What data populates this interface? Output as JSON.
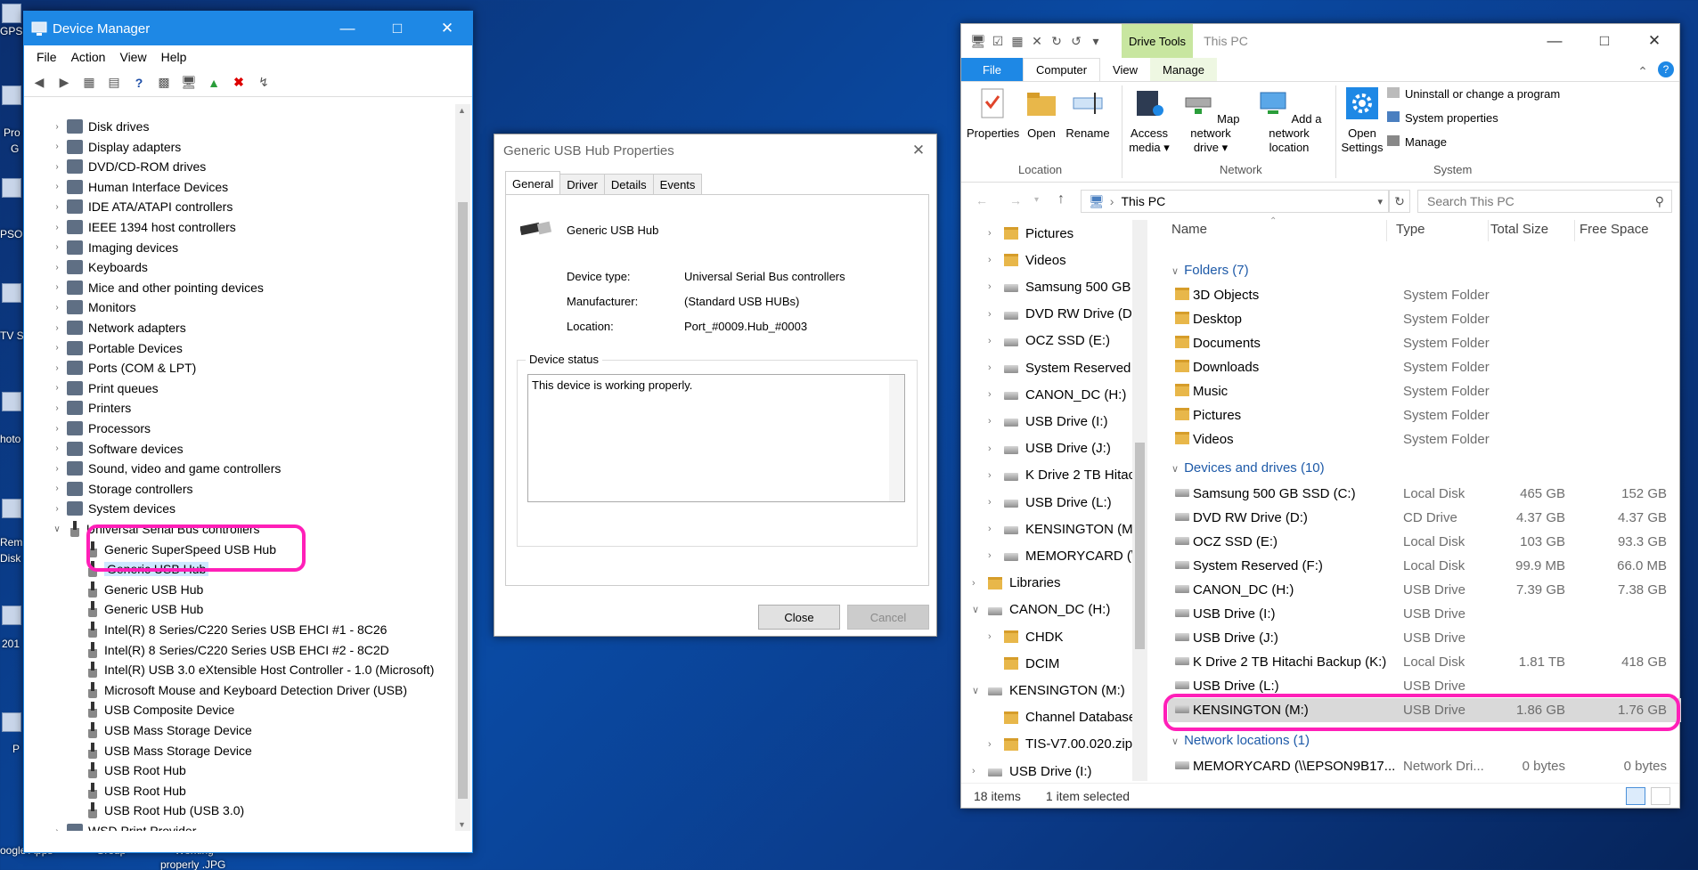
{
  "desktop": {
    "labels": [
      {
        "text": "GPS"
      },
      {
        "text": "Pro"
      },
      {
        "text": "G"
      },
      {
        "text": "PSO"
      },
      {
        "text": "TV S"
      },
      {
        "text": "hoto"
      },
      {
        "text": "Rem"
      },
      {
        "text": "Disk"
      },
      {
        "text": "201"
      },
      {
        "text": "P"
      },
      {
        "text": "oogle Apps"
      },
      {
        "text": "Group"
      },
      {
        "text": "Working"
      },
      {
        "text": "properly .JPG"
      }
    ]
  },
  "device_manager": {
    "title": "Device Manager",
    "menu": [
      "File",
      "Action",
      "View",
      "Help"
    ],
    "tree": [
      {
        "label": "Disk drives",
        "icon": "disk-drive-icon"
      },
      {
        "label": "Display adapters",
        "icon": "display-adapter-icon"
      },
      {
        "label": "DVD/CD-ROM drives",
        "icon": "dvd-drive-icon"
      },
      {
        "label": "Human Interface Devices",
        "icon": "hid-icon"
      },
      {
        "label": "IDE ATA/ATAPI controllers",
        "icon": "ide-controller-icon"
      },
      {
        "label": "IEEE 1394 host controllers",
        "icon": "firewire-icon"
      },
      {
        "label": "Imaging devices",
        "icon": "camera-icon"
      },
      {
        "label": "Keyboards",
        "icon": "keyboard-icon"
      },
      {
        "label": "Mice and other pointing devices",
        "icon": "mouse-icon"
      },
      {
        "label": "Monitors",
        "icon": "monitor-icon"
      },
      {
        "label": "Network adapters",
        "icon": "network-adapter-icon"
      },
      {
        "label": "Portable Devices",
        "icon": "portable-device-icon"
      },
      {
        "label": "Ports (COM & LPT)",
        "icon": "port-icon"
      },
      {
        "label": "Print queues",
        "icon": "print-queue-icon"
      },
      {
        "label": "Printers",
        "icon": "printer-icon"
      },
      {
        "label": "Processors",
        "icon": "processor-icon"
      },
      {
        "label": "Software devices",
        "icon": "software-device-icon"
      },
      {
        "label": "Sound, video and game controllers",
        "icon": "sound-icon"
      },
      {
        "label": "Storage controllers",
        "icon": "storage-controller-icon"
      },
      {
        "label": "System devices",
        "icon": "system-device-icon"
      },
      {
        "label": "Universal Serial Bus controllers",
        "icon": "usb-icon"
      }
    ],
    "usb_children": [
      "Generic SuperSpeed USB Hub",
      "Generic USB Hub",
      "Generic USB Hub",
      "Generic USB Hub",
      "Intel(R) 8 Series/C220 Series USB EHCI #1 - 8C26",
      "Intel(R) 8 Series/C220 Series USB EHCI #2 - 8C2D",
      "Intel(R) USB 3.0 eXtensible Host Controller - 1.0 (Microsoft)",
      "Microsoft Mouse and Keyboard Detection Driver (USB)",
      "USB Composite Device",
      "USB Mass Storage Device",
      "USB Mass Storage Device",
      "USB Root Hub",
      "USB Root Hub",
      "USB Root Hub (USB 3.0)"
    ],
    "last_item": "WSD Print Provider"
  },
  "properties": {
    "title": "Generic USB Hub Properties",
    "tabs": [
      "General",
      "Driver",
      "Details",
      "Events"
    ],
    "device_name": "Generic USB Hub",
    "fields": [
      {
        "label": "Device type:",
        "value": "Universal Serial Bus controllers"
      },
      {
        "label": "Manufacturer:",
        "value": "(Standard USB HUBs)"
      },
      {
        "label": "Location:",
        "value": "Port_#0009.Hub_#0003"
      }
    ],
    "status_group": "Device status",
    "status_text": "This device is working properly.",
    "close_label": "Close",
    "cancel_label": "Cancel"
  },
  "explorer": {
    "title": "This PC",
    "drive_tools": "Drive Tools",
    "ribbon_tabs": [
      "File",
      "Computer",
      "View",
      "Manage"
    ],
    "ribbon": {
      "properties": "Properties",
      "open": "Open",
      "rename": "Rename",
      "access_media": "Access",
      "access_media2": "media",
      "map_drive": "Map network",
      "map_drive2": "drive",
      "add_location": "Add a network",
      "add_location2": "location",
      "open_settings": "Open",
      "open_settings2": "Settings",
      "uninstall": "Uninstall or change a program",
      "system_props": "System properties",
      "manage": "Manage",
      "group_location": "Location",
      "group_network": "Network",
      "group_system": "System"
    },
    "address": "This PC",
    "search_placeholder": "Search This PC",
    "nav": [
      {
        "label": "Pictures",
        "icon": "folder"
      },
      {
        "label": "Videos",
        "icon": "folder"
      },
      {
        "label": "Samsung 500 GB",
        "icon": "drive"
      },
      {
        "label": "DVD RW Drive (D",
        "icon": "drive"
      },
      {
        "label": "OCZ SSD (E:)",
        "icon": "drive"
      },
      {
        "label": "System Reserved",
        "icon": "drive"
      },
      {
        "label": "CANON_DC (H:)",
        "icon": "drive"
      },
      {
        "label": "USB Drive (I:)",
        "icon": "drive"
      },
      {
        "label": "USB Drive (J:)",
        "icon": "drive"
      },
      {
        "label": "K Drive 2 TB Hitac",
        "icon": "drive"
      },
      {
        "label": "USB Drive (L:)",
        "icon": "drive"
      },
      {
        "label": "KENSINGTON (M:",
        "icon": "drive"
      },
      {
        "label": "MEMORYCARD (\\",
        "icon": "drive"
      },
      {
        "label": "Libraries",
        "icon": "folder"
      },
      {
        "label": "CANON_DC (H:)",
        "icon": "drive"
      },
      {
        "label": "CHDK",
        "icon": "folder"
      },
      {
        "label": "DCIM",
        "icon": "folder"
      },
      {
        "label": "KENSINGTON (M:)",
        "icon": "drive"
      },
      {
        "label": "Channel Database",
        "icon": "folder"
      },
      {
        "label": "TIS-V7.00.020.zip",
        "icon": "folder"
      },
      {
        "label": "USB Drive (I:)",
        "icon": "drive"
      }
    ],
    "columns": [
      "Name",
      "Type",
      "Total Size",
      "Free Space"
    ],
    "folders_group": "Folders (7)",
    "folders": [
      {
        "name": "3D Objects",
        "type": "System Folder"
      },
      {
        "name": "Desktop",
        "type": "System Folder"
      },
      {
        "name": "Documents",
        "type": "System Folder"
      },
      {
        "name": "Downloads",
        "type": "System Folder"
      },
      {
        "name": "Music",
        "type": "System Folder"
      },
      {
        "name": "Pictures",
        "type": "System Folder"
      },
      {
        "name": "Videos",
        "type": "System Folder"
      }
    ],
    "drives_group": "Devices and drives (10)",
    "drives": [
      {
        "name": "Samsung 500 GB SSD (C:)",
        "type": "Local Disk",
        "total": "465 GB",
        "free": "152 GB"
      },
      {
        "name": "DVD RW Drive (D:)",
        "type": "CD Drive",
        "total": "4.37 GB",
        "free": "4.37 GB"
      },
      {
        "name": "OCZ SSD (E:)",
        "type": "Local Disk",
        "total": "103 GB",
        "free": "93.3 GB"
      },
      {
        "name": "System Reserved (F:)",
        "type": "Local Disk",
        "total": "99.9 MB",
        "free": "66.0 MB"
      },
      {
        "name": "CANON_DC (H:)",
        "type": "USB Drive",
        "total": "7.39 GB",
        "free": "7.38 GB"
      },
      {
        "name": "USB Drive (I:)",
        "type": "USB Drive",
        "total": "",
        "free": ""
      },
      {
        "name": "USB Drive (J:)",
        "type": "USB Drive",
        "total": "",
        "free": ""
      },
      {
        "name": "K Drive 2 TB Hitachi Backup (K:)",
        "type": "Local Disk",
        "total": "1.81 TB",
        "free": "418 GB"
      },
      {
        "name": "USB Drive (L:)",
        "type": "USB Drive",
        "total": "",
        "free": ""
      },
      {
        "name": "KENSINGTON (M:)",
        "type": "USB Drive",
        "total": "1.86 GB",
        "free": "1.76 GB"
      }
    ],
    "network_group": "Network locations (1)",
    "network": [
      {
        "name": "MEMORYCARD (\\\\EPSON9B17...",
        "type": "Network Dri...",
        "total": "0 bytes",
        "free": "0 bytes"
      }
    ],
    "status_items": "18 items",
    "status_selected": "1 item selected"
  },
  "colors": {
    "accent": "#1e88e5",
    "highlight": "#ff1fb8",
    "selection": "#cce8ff"
  }
}
